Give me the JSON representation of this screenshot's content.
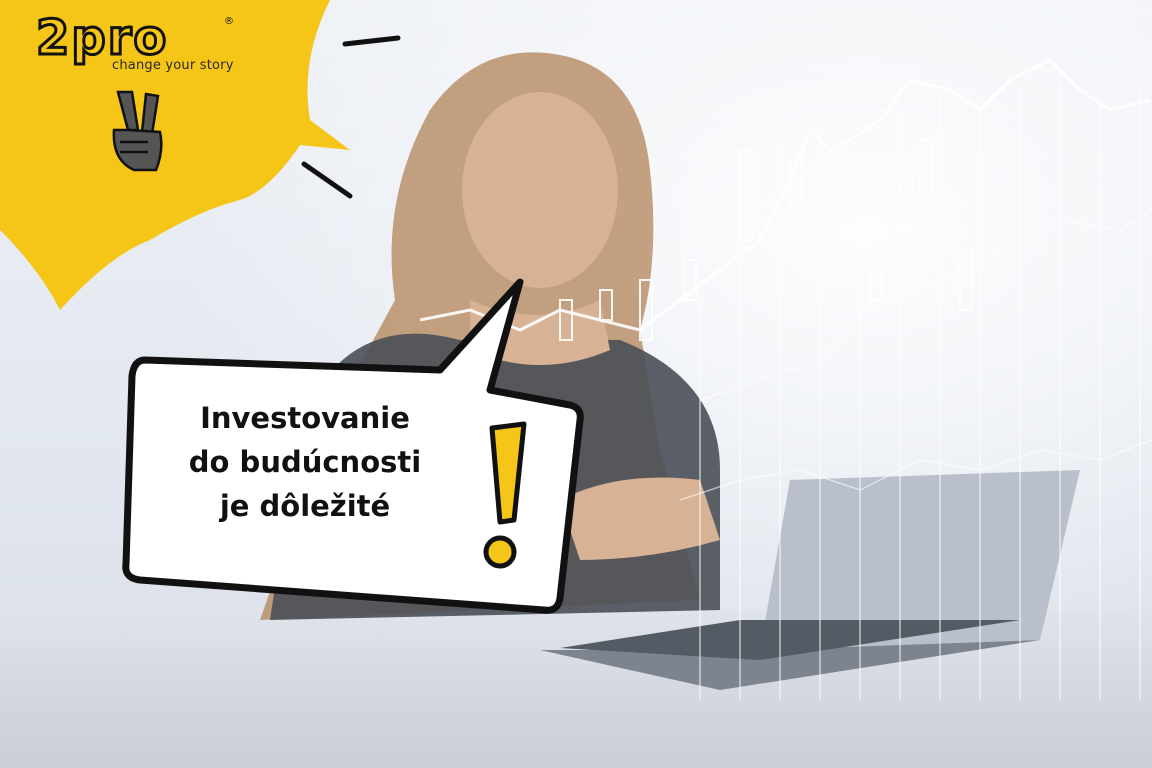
{
  "brand": {
    "logo_text": "2pro",
    "registered_mark": "®",
    "tagline": "change your story"
  },
  "bubble": {
    "lines": [
      "Investovanie",
      "do budúcnosti",
      "je dôležité"
    ],
    "exclamation": "!"
  },
  "icons": {
    "victory_hand": "victory-hand-icon",
    "exclamation": "exclamation-icon"
  },
  "colors": {
    "brand_yellow": "#f5c518",
    "ink": "#111111",
    "chart_light": "#ffffff"
  }
}
